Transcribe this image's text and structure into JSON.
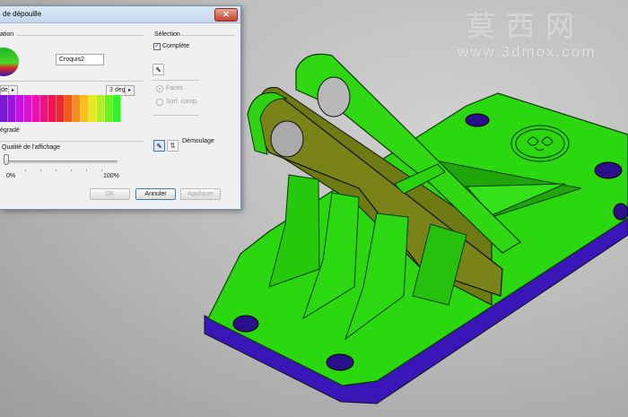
{
  "watermark": {
    "chinese": "莫西网",
    "url": "www.3dmox.com"
  },
  "dialog": {
    "title": "de dépouille",
    "close_icon": "close-icon",
    "left": {
      "group_label": "ation",
      "sphere_icon": "color-sphere-icon",
      "sketch_name": "Croquis2",
      "start_angle": "deg",
      "end_angle": "3 deg",
      "palette_colors": [
        "#7a1bd6",
        "#a012e0",
        "#c611e3",
        "#e010d2",
        "#ee11ad",
        "#f0127e",
        "#ee1550",
        "#ea2a28",
        "#ef5a1a",
        "#f5901a",
        "#f9c01c",
        "#e7ea1f",
        "#b1ef20",
        "#6bf223",
        "#2ef428"
      ],
      "gradient_label": "égradé",
      "quality_label": "Qualité de l'affichage",
      "quality_value": 0.0,
      "min_label": "0%",
      "max_label": "100%"
    },
    "right": {
      "group_label": "Sélection",
      "complete_label": "Complète",
      "complete_checked": true,
      "faces_label": "Faces",
      "surf_label": "Surf. comp.",
      "demoulage_label": "Démoulage"
    },
    "buttons": {
      "ok": "OK",
      "cancel": "Annuler",
      "apply": "Appliquer"
    }
  }
}
